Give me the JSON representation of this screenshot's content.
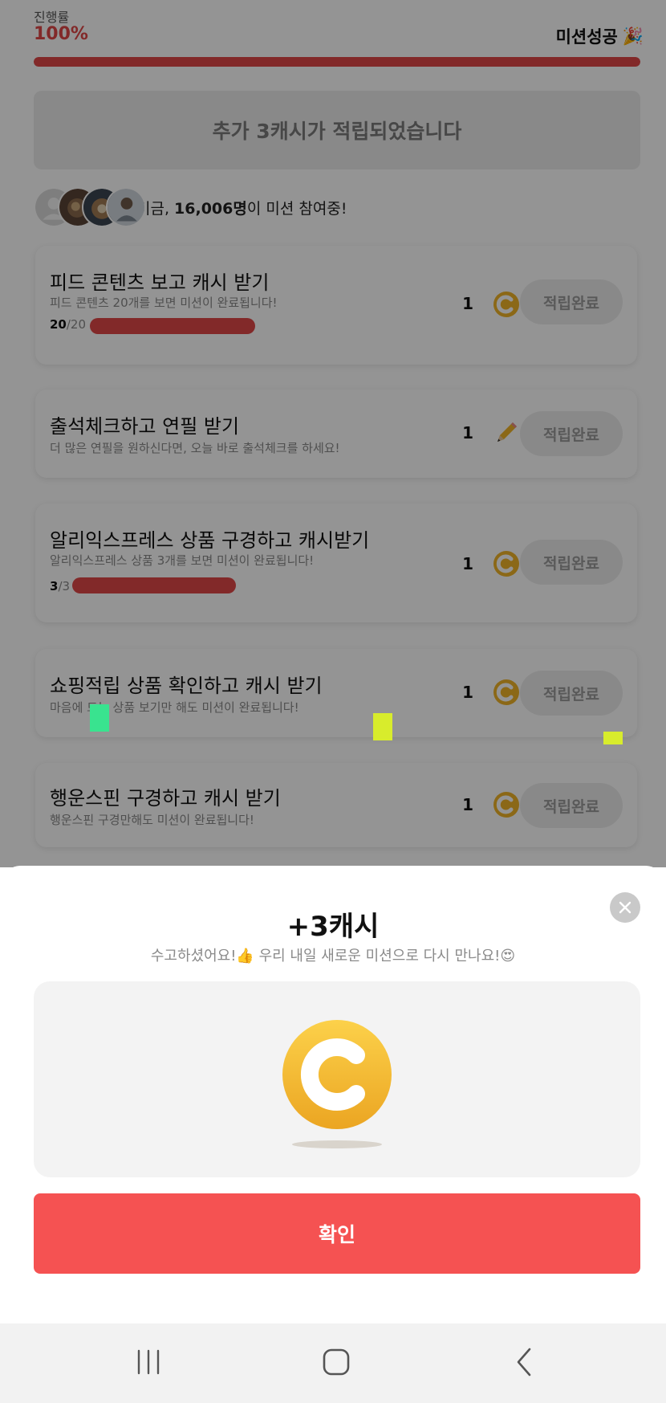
{
  "header": {
    "progress_label": "진행률",
    "progress_value": "100%",
    "progress_fraction": 1.0,
    "mission_status": "미션성공",
    "mission_status_emoji": "🎉"
  },
  "banner": {
    "text": "추가 3캐시가 적립되었습니다"
  },
  "participants": {
    "prefix": "지금, ",
    "count": "16,006명",
    "suffix": "이 미션 참여중!"
  },
  "missions": [
    {
      "title": "피드 콘텐츠 보고 캐시 받기",
      "desc": "피드 콘텐츠 20개를 보면 미션이 완료됩니다!",
      "count_done": "20",
      "count_total": "/20",
      "progress": 1.0,
      "reward": "1",
      "reward_icon": "coin-icon",
      "button": "적립완료"
    },
    {
      "title": "출석체크하고 연필 받기",
      "desc": "더 많은 연필을 원하신다면, 오늘 바로 출석체크를 하세요!",
      "reward": "1",
      "reward_icon": "pencil-icon",
      "button": "적립완료"
    },
    {
      "title": "알리익스프레스 상품 구경하고 캐시받기",
      "desc": "알리익스프레스 상품 3개를 보면 미션이 완료됩니다!",
      "count_done": "3",
      "count_total": "/3",
      "progress": 1.0,
      "reward": "1",
      "reward_icon": "coin-icon",
      "button": "적립완료"
    },
    {
      "title": "쇼핑적립 상품 확인하고 캐시 받기",
      "desc": "마음에 드는 상품 보기만 해도 미션이 완료됩니다!",
      "reward": "1",
      "reward_icon": "coin-icon",
      "button": "적립완료"
    },
    {
      "title": "행운스핀 구경하고 캐시 받기",
      "desc": "행운스핀 구경만해도 미션이 완료됩니다!",
      "reward": "1",
      "reward_icon": "coin-icon",
      "button": "적립완료"
    }
  ],
  "sheet": {
    "title": "+3캐시",
    "subtitle": "수고하셨어요!👍 우리 내일 새로운 미션으로 다시 만나요!😍",
    "confirm": "확인",
    "close_icon": "close-icon"
  },
  "navbar": {
    "recent_icon": "recent-apps-icon",
    "home_icon": "home-icon",
    "back_icon": "back-icon"
  },
  "colors": {
    "accent": "#e04848",
    "confirm": "#f55252",
    "coin": "#f0b429"
  }
}
